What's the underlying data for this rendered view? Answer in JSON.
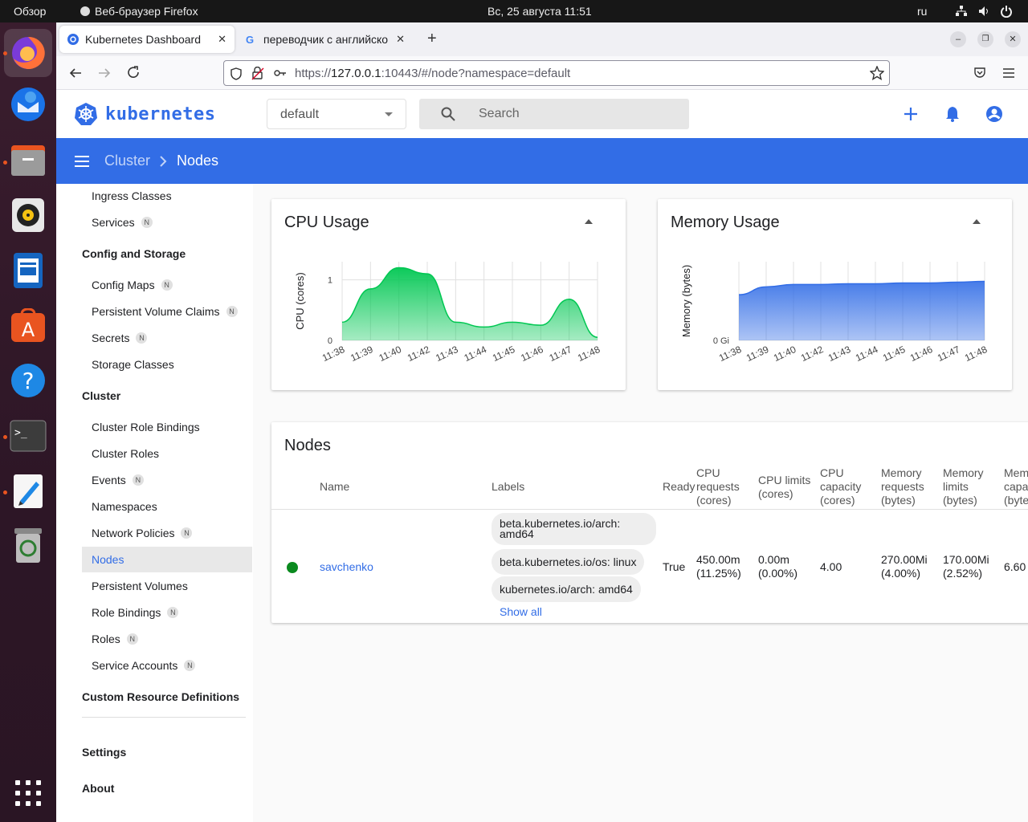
{
  "topbar": {
    "overview": "Обзор",
    "app": "Веб-браузер Firefox",
    "datetime": "Вс, 25 августа  11:51",
    "lang": "ru"
  },
  "tabs": [
    {
      "title": "Kubernetes Dashboard"
    },
    {
      "title": "переводчик с английско"
    }
  ],
  "url": {
    "prefix": "https://",
    "host": "127.0.0.1",
    "rest": ":10443/#/node?namespace=default"
  },
  "k8s": {
    "logo_text": "kubernetes",
    "namespace": "default",
    "search_placeholder": "Search"
  },
  "breadcrumb": {
    "parent": "Cluster",
    "current": "Nodes"
  },
  "sidebar": {
    "items_top": [
      {
        "label": "Ingress Classes",
        "ns": ""
      },
      {
        "label": "Services",
        "ns": "N"
      }
    ],
    "section_config": "Config and Storage",
    "items_config": [
      {
        "label": "Config Maps",
        "ns": "N"
      },
      {
        "label": "Persistent Volume Claims",
        "ns": "N"
      },
      {
        "label": "Secrets",
        "ns": "N"
      },
      {
        "label": "Storage Classes",
        "ns": ""
      }
    ],
    "section_cluster": "Cluster",
    "items_cluster": [
      {
        "label": "Cluster Role Bindings",
        "ns": ""
      },
      {
        "label": "Cluster Roles",
        "ns": ""
      },
      {
        "label": "Events",
        "ns": "N"
      },
      {
        "label": "Namespaces",
        "ns": ""
      },
      {
        "label": "Network Policies",
        "ns": "N"
      },
      {
        "label": "Nodes",
        "ns": ""
      },
      {
        "label": "Persistent Volumes",
        "ns": ""
      },
      {
        "label": "Role Bindings",
        "ns": "N"
      },
      {
        "label": "Roles",
        "ns": "N"
      },
      {
        "label": "Service Accounts",
        "ns": "N"
      }
    ],
    "section_crd": "Custom Resource Definitions",
    "settings": "Settings",
    "about": "About"
  },
  "chart_data": [
    {
      "type": "area",
      "title": "CPU Usage",
      "ylabel": "CPU (cores)",
      "x": [
        "11:38",
        "11:39",
        "11:40",
        "11:42",
        "11:43",
        "11:44",
        "11:45",
        "11:46",
        "11:47",
        "11:48"
      ],
      "values": [
        0.3,
        0.85,
        1.2,
        1.1,
        0.3,
        0.22,
        0.3,
        0.25,
        0.68,
        0.05
      ],
      "y_ticks": [
        "0",
        "1"
      ],
      "ylim": [
        0,
        1.3
      ],
      "color": "#00c752"
    },
    {
      "type": "area",
      "title": "Memory Usage",
      "ylabel": "Memory (bytes)",
      "x": [
        "11:38",
        "11:39",
        "11:40",
        "11:42",
        "11:43",
        "11:44",
        "11:45",
        "11:46",
        "11:47",
        "11:48"
      ],
      "values": [
        0.58,
        0.68,
        0.71,
        0.71,
        0.72,
        0.72,
        0.73,
        0.73,
        0.74,
        0.75
      ],
      "y_ticks": [
        "0 Gi"
      ],
      "ylim": [
        0,
        1
      ],
      "color": "#326de6"
    }
  ],
  "nodes": {
    "title": "Nodes",
    "headers": {
      "name": "Name",
      "labels": "Labels",
      "ready": "Ready",
      "cpu_req": "CPU requests (cores)",
      "cpu_lim": "CPU limits (cores)",
      "cpu_cap": "CPU capacity (cores)",
      "mem_req": "Memory requests (bytes)",
      "mem_lim": "Memory limits (bytes)",
      "mem_cap": "Memory capacity (bytes)"
    },
    "rows": [
      {
        "name": "savchenko",
        "labels": [
          "beta.kubernetes.io/arch: amd64",
          "beta.kubernetes.io/os: linux",
          "kubernetes.io/arch: amd64"
        ],
        "show_all": "Show all",
        "ready": "True",
        "cpu_req": "450.00m",
        "cpu_req_pct": "(11.25%)",
        "cpu_lim": "0.00m",
        "cpu_lim_pct": "(0.00%)",
        "cpu_cap": "4.00",
        "mem_req": "270.00Mi",
        "mem_req_pct": "(4.00%)",
        "mem_lim": "170.00Mi",
        "mem_lim_pct": "(2.52%)",
        "mem_cap": "6.60"
      }
    ]
  }
}
